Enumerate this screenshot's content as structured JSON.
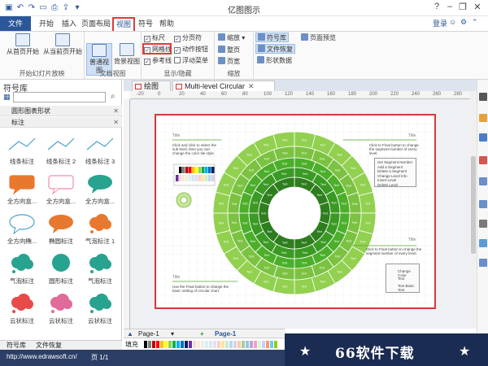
{
  "app": {
    "title": "亿图图示"
  },
  "quick_access": [
    "save-icon",
    "undo-icon",
    "redo-icon",
    "open-icon",
    "print-icon",
    "export-icon"
  ],
  "window_controls": {
    "help": "?",
    "minimize": "–",
    "restore": "❐",
    "close": "✕"
  },
  "tabs": {
    "file": "文件",
    "start": "开始",
    "insert": "插入",
    "page_layout": "页面布局",
    "view": "视图",
    "symbol": "符号",
    "help": "帮助"
  },
  "topright": {
    "login": "登录"
  },
  "ribbon": {
    "slideshow": {
      "from_start": "从首页开始",
      "from_current": "从当前页开始",
      "group": "开始幻灯片放映"
    },
    "docview": {
      "normal": "普通视图",
      "background": "背景视图",
      "group": "文档视图"
    },
    "show": {
      "ruler": "标尺",
      "grid": "网格线",
      "guides": "参考线",
      "page_break": "分页符",
      "action_button": "动作按钮",
      "float_menu": "浮动菜单",
      "group": "显示/隐藏"
    },
    "zoom": {
      "zoom": "缩放",
      "fit_page": "整页",
      "page_width": "页宽",
      "group": "缩放"
    },
    "pane": {
      "symbol_lib": "符号库",
      "file_recovery": "文件恢复",
      "page_preview": "页面预览",
      "shape_data": "形状数据"
    }
  },
  "left_panel": {
    "title": "符号库",
    "sections": [
      "圆形图表形状",
      "标注"
    ],
    "shapes": [
      {
        "label": "线条标注",
        "icon": "line-callout-icon"
      },
      {
        "label": "线条标注 2",
        "icon": "line-callout-2-icon"
      },
      {
        "label": "线条标注 3",
        "icon": "line-callout-3-icon"
      },
      {
        "label": "全方向盒...",
        "icon": "rect-callout-orange-icon"
      },
      {
        "label": "全方向盒...",
        "icon": "rect-callout-pink-icon"
      },
      {
        "label": "全方向盒...",
        "icon": "oval-callout-teal-icon"
      },
      {
        "label": "全方向椭...",
        "icon": "oval-callout-outline-icon"
      },
      {
        "label": "椭圆标注",
        "icon": "oval-callout-orange-icon"
      },
      {
        "label": "气泡标注 1",
        "icon": "cloud-callout-orange-icon"
      },
      {
        "label": "气泡标注",
        "icon": "cloud-callout-teal-icon"
      },
      {
        "label": "圆形标注",
        "icon": "circle-callout-teal-icon"
      },
      {
        "label": "气泡标注",
        "icon": "cloud-callout-teal2-icon"
      },
      {
        "label": "云状标注",
        "icon": "cloud-callout-red-icon"
      },
      {
        "label": "云状标注",
        "icon": "cloud-callout-pink-icon"
      },
      {
        "label": "云状标注",
        "icon": "cloud-callout-teal3-icon"
      }
    ],
    "bottom_tabs": [
      "符号库",
      "文件恢复"
    ]
  },
  "doc_tabs": [
    {
      "label": "绘图1"
    },
    {
      "label": "Multi-level Circular"
    }
  ],
  "ruler_ticks": [
    "-20",
    "0",
    "20",
    "40",
    "60",
    "80",
    "100",
    "120",
    "140",
    "160",
    "180",
    "200",
    "220",
    "240",
    "260",
    "280"
  ],
  "diagram": {
    "title_tl": "Title",
    "note_tl": "Click and click to select the sub level, then you can change the color tile style.",
    "title_tr": "Title",
    "note_tr": "Click to Float button to change the segment number of every level.",
    "title_br": "Title",
    "note_br": "Click to Float button to change the segment number of every level.",
    "title_bl": "Title",
    "note_bl": "Use the Float button to change the basic setting of circular chart.",
    "ring_label": "Text",
    "menu_items": [
      "Set Segment Number",
      "Add a Segment",
      "Delete a Segment",
      "Change Level Info",
      "Insert Level",
      "Delete Level"
    ],
    "float_items": [
      "Change Color",
      "Text",
      "Text Basic Text"
    ]
  },
  "page_bar": {
    "page_name": "Page-1",
    "add": "+",
    "active_page": "Page-1"
  },
  "palette": {
    "label": "填充",
    "colors": [
      "#ffffff",
      "#000000",
      "#7f7f7f",
      "#c00000",
      "#ff0000",
      "#ffc000",
      "#ffff00",
      "#92d050",
      "#00b050",
      "#00b0f0",
      "#0070c0",
      "#002060",
      "#7030a0",
      "#f2dcdb",
      "#fde9d9",
      "#ebf1dd",
      "#dbeef3",
      "#dce6f1",
      "#e5e0ec",
      "#ffcccc",
      "#ffe699",
      "#c6efce",
      "#bdd7ee",
      "#d9d2e9",
      "#f8cbad",
      "#a9d08e",
      "#9bc2e6",
      "#b4a7d6",
      "#ff99cc",
      "#ccffcc",
      "#ccccff",
      "#ff9966",
      "#66ccff",
      "#99cc00"
    ]
  },
  "status": {
    "link": "http://www.edrawsoft.cn/",
    "page": "页 1/1"
  },
  "promo": {
    "text": "66软件下载",
    "star": "★"
  },
  "colors": {
    "accent": "#2b579a",
    "highlight": "#e03a3a",
    "ring_outer": "#92d050",
    "ring_mid": "#4caf2a",
    "ring_inner": "#2e7d1e"
  }
}
